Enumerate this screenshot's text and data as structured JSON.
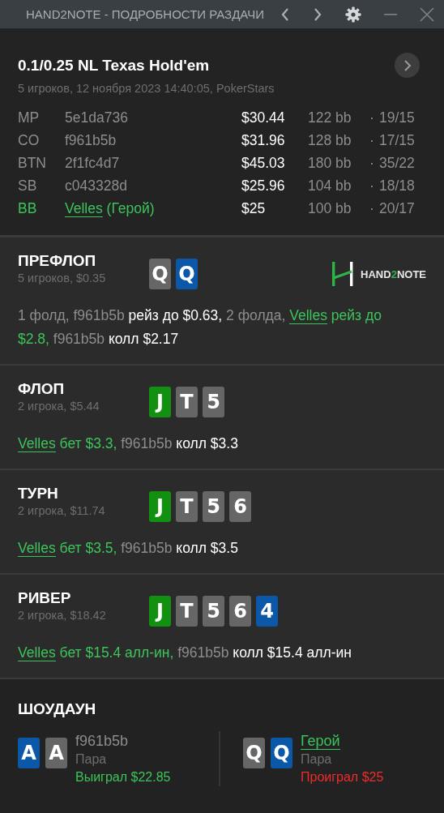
{
  "window": {
    "title": "HAND2NOTE - ПОДРОБНОСТИ РАЗДАЧИ"
  },
  "hand": {
    "title": "0.1/0.25 NL Texas Hold'em",
    "subtitle": "5 игроков, 12 ноября 2023 14:40:05, PokerStars",
    "players": [
      {
        "position": "MP",
        "name": "5e1da736",
        "hero": false,
        "stack": "$30.44",
        "bb": "122 bb",
        "sep": "·",
        "stats": "19/15"
      },
      {
        "position": "CO",
        "name": "f961b5b",
        "hero": false,
        "stack": "$31.96",
        "bb": "128 bb",
        "sep": "·",
        "stats": "17/15"
      },
      {
        "position": "BTN",
        "name": "2f1fc4d7",
        "hero": false,
        "stack": "$45.03",
        "bb": "180 bb",
        "sep": "·",
        "stats": "35/22"
      },
      {
        "position": "SB",
        "name": "c043328d",
        "hero": false,
        "stack": "$25.96",
        "bb": "104 bb",
        "sep": "·",
        "stats": "18/18"
      },
      {
        "position": "BB",
        "name": "Velles",
        "name_suffix": " (Герой)",
        "hero": true,
        "stack": "$25",
        "bb": "100 bb",
        "sep": "·",
        "stats": "20/17"
      }
    ]
  },
  "streets": [
    {
      "name": "ПРЕФЛОП",
      "info": "5 игроков, $0.35",
      "logo": {
        "text_a": "HAND",
        "text_b": "2",
        "text_c": "NOTE"
      },
      "cards": [
        {
          "rank": "Q",
          "color": "#666666"
        },
        {
          "rank": "Q",
          "color": "#0b57a8"
        }
      ],
      "actions": [
        {
          "kind": "player",
          "text": "1 фолд, f961b5b "
        },
        {
          "kind": "action",
          "text": "рейз до $0.63, "
        },
        {
          "kind": "player",
          "text": "2 фолда, "
        },
        {
          "kind": "hero",
          "text": "Velles"
        },
        {
          "kind": "hero_action",
          "text": " рейз до $2.8, "
        },
        {
          "kind": "player",
          "text": "f961b5b "
        },
        {
          "kind": "action",
          "text": "колл $2.17"
        }
      ]
    },
    {
      "name": "ФЛОП",
      "info": "2 игрока, $5.44",
      "cards": [
        {
          "rank": "J",
          "color": "#12900f"
        },
        {
          "rank": "T",
          "color": "#666666"
        },
        {
          "rank": "5",
          "color": "#666666"
        }
      ],
      "actions": [
        {
          "kind": "hero",
          "text": "Velles"
        },
        {
          "kind": "hero_action",
          "text": " бет $3.3, "
        },
        {
          "kind": "player",
          "text": "f961b5b "
        },
        {
          "kind": "action",
          "text": "колл $3.3"
        }
      ]
    },
    {
      "name": "ТУРН",
      "info": "2 игрока, $11.74",
      "cards": [
        {
          "rank": "J",
          "color": "#12900f"
        },
        {
          "rank": "T",
          "color": "#666666"
        },
        {
          "rank": "5",
          "color": "#666666"
        },
        {
          "rank": "6",
          "color": "#666666"
        }
      ],
      "actions": [
        {
          "kind": "hero",
          "text": "Velles"
        },
        {
          "kind": "hero_action",
          "text": " бет $3.5, "
        },
        {
          "kind": "player",
          "text": "f961b5b "
        },
        {
          "kind": "action",
          "text": "колл $3.5"
        }
      ]
    },
    {
      "name": "РИВЕР",
      "info": "2 игрока, $18.42",
      "cards": [
        {
          "rank": "J",
          "color": "#12900f"
        },
        {
          "rank": "T",
          "color": "#666666"
        },
        {
          "rank": "5",
          "color": "#666666"
        },
        {
          "rank": "6",
          "color": "#666666"
        },
        {
          "rank": "4",
          "color": "#0b57a8"
        }
      ],
      "actions": [
        {
          "kind": "hero",
          "text": "Velles"
        },
        {
          "kind": "hero_action",
          "text": " бет $15.4 алл-ин, "
        },
        {
          "kind": "player",
          "text": "f961b5b "
        },
        {
          "kind": "action",
          "text": "колл $15.4 алл-ин"
        }
      ]
    }
  ],
  "showdown": {
    "title": "ШОУДАУН",
    "hands": [
      {
        "name": "f961b5b",
        "hero": false,
        "combo": "Пара",
        "result": "Выиграл $22.85",
        "won": true,
        "cards": [
          {
            "rank": "A",
            "color": "#0b57a8"
          },
          {
            "rank": "A",
            "color": "#666666"
          }
        ]
      },
      {
        "name": "Герой",
        "hero": true,
        "combo": "Пара",
        "result": "Проиграл $25",
        "won": false,
        "cards": [
          {
            "rank": "Q",
            "color": "#666666"
          },
          {
            "rank": "Q",
            "color": "#0b57a8"
          }
        ]
      }
    ]
  }
}
